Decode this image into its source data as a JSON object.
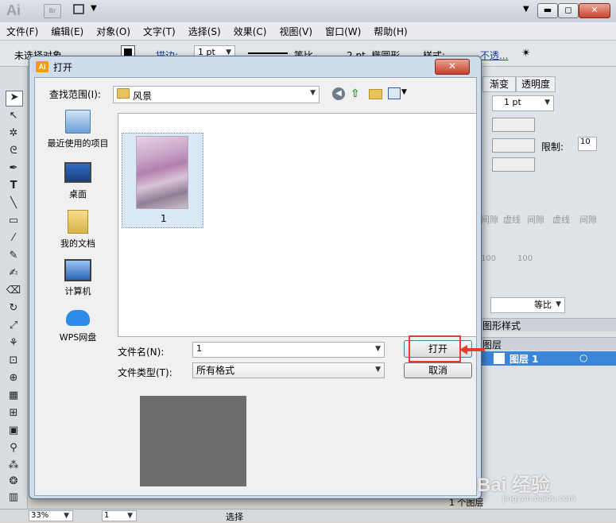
{
  "app": {
    "logo": "Ai",
    "menus": [
      "文件(F)",
      "编辑(E)",
      "对象(O)",
      "文字(T)",
      "选择(S)",
      "效果(C)",
      "视图(V)",
      "窗口(W)",
      "帮助(H)"
    ],
    "control_bar": {
      "selection_label": "未选择对象",
      "stroke_label": "描边:",
      "stroke_value": "1 pt",
      "equal_label": "等比",
      "brush_size": "2 pt. 椭圆形",
      "style_label": "样式:",
      "opacity_label": "不透..."
    },
    "status": {
      "zoom": "33%",
      "page": "1",
      "tool": "选择"
    },
    "panels": {
      "tabs": [
        "渐变",
        "透明度"
      ],
      "weight_value": "1 pt",
      "limit_label": "限制:",
      "limit_value": "10",
      "dash_labels": [
        "间隙",
        "虚线",
        "间隙",
        "虚线",
        "间隙"
      ],
      "percent_a": "100",
      "percent_b": "100",
      "profile_label": "等比",
      "graphic_styles_label": "图形样式",
      "layers_tab": "图层",
      "layer_name": "图层 1",
      "layers_count": "1 个图层"
    }
  },
  "dialog": {
    "title": "打开",
    "close_label": "✕",
    "look_in_label": "查找范围(I):",
    "look_in_value": "风景",
    "places": [
      {
        "label": "最近使用的项目",
        "icon": "recent-items-icon"
      },
      {
        "label": "桌面",
        "icon": "desktop-icon"
      },
      {
        "label": "我的文档",
        "icon": "documents-folder-icon"
      },
      {
        "label": "计算机",
        "icon": "computer-icon"
      },
      {
        "label": "WPS网盘",
        "icon": "cloud-icon"
      }
    ],
    "file_item_name": "1",
    "filename_label": "文件名(N):",
    "filename_value": "1",
    "filetype_label": "文件类型(T):",
    "filetype_value": "所有格式",
    "open_button": "打开",
    "cancel_button": "取消"
  },
  "watermark": {
    "text": "Bai 经验",
    "url": "jingyan.baidu.com"
  },
  "colors": {
    "highlight": "#e53d30",
    "selection": "#dbe8f8",
    "layer_row": "#3b86d6"
  }
}
